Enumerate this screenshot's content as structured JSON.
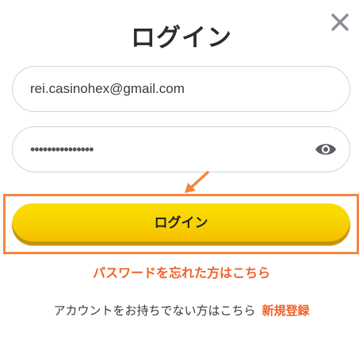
{
  "title": "ログイン",
  "email_value": "rei.casinohex@gmail.com",
  "password_value": "•••••••••••••••",
  "login_button": "ログイン",
  "forgot_link": "パスワードを忘れた方はこちら",
  "no_account_text": "アカウントをお持ちでない方はこちら",
  "register_link": "新規登録",
  "icons": {
    "close": "close-icon",
    "password_toggle": "eye-icon",
    "annotation": "arrow-icon"
  },
  "colors": {
    "accent": "#f0622a",
    "highlight_border": "#f3873f",
    "button": "#f8cf00"
  }
}
